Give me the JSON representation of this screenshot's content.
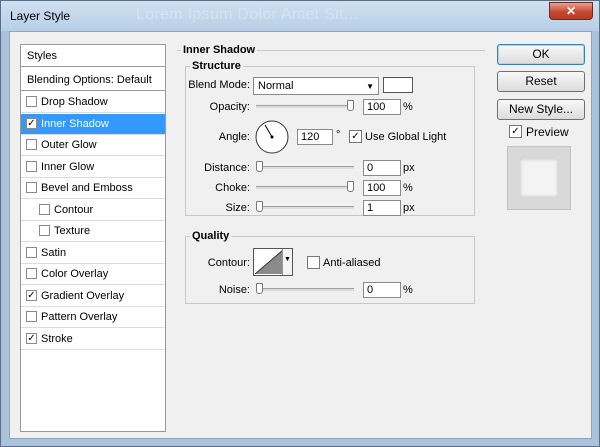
{
  "window": {
    "title": "Layer Style",
    "ghost_title": "Lorem Ipsum Dolor Amet Sit..."
  },
  "styles_panel": {
    "header": "Styles",
    "blending": "Blending Options: Default",
    "items": [
      {
        "label": "Drop Shadow",
        "checked": false,
        "indent": false,
        "selected": false
      },
      {
        "label": "Inner Shadow",
        "checked": true,
        "indent": false,
        "selected": true
      },
      {
        "label": "Outer Glow",
        "checked": false,
        "indent": false,
        "selected": false
      },
      {
        "label": "Inner Glow",
        "checked": false,
        "indent": false,
        "selected": false
      },
      {
        "label": "Bevel and Emboss",
        "checked": false,
        "indent": false,
        "selected": false
      },
      {
        "label": "Contour",
        "checked": false,
        "indent": true,
        "selected": false
      },
      {
        "label": "Texture",
        "checked": false,
        "indent": true,
        "selected": false
      },
      {
        "label": "Satin",
        "checked": false,
        "indent": false,
        "selected": false
      },
      {
        "label": "Color Overlay",
        "checked": false,
        "indent": false,
        "selected": false
      },
      {
        "label": "Gradient Overlay",
        "checked": true,
        "indent": false,
        "selected": false
      },
      {
        "label": "Pattern Overlay",
        "checked": false,
        "indent": false,
        "selected": false
      },
      {
        "label": "Stroke",
        "checked": true,
        "indent": false,
        "selected": false
      }
    ]
  },
  "inner_shadow": {
    "section_title": "Inner Shadow",
    "structure_title": "Structure",
    "blend_mode_label": "Blend Mode:",
    "blend_mode_value": "Normal",
    "shadow_color": "#ffffff",
    "opacity_label": "Opacity:",
    "opacity_value": "100",
    "opacity_unit": "%",
    "opacity_level": 1.0,
    "angle_label": "Angle:",
    "angle_value": "120",
    "angle_unit": "°",
    "global_light_label": "Use Global Light",
    "global_light_checked": true,
    "distance_label": "Distance:",
    "distance_value": "0",
    "distance_unit": "px",
    "distance_level": 0.0,
    "choke_label": "Choke:",
    "choke_value": "100",
    "choke_unit": "%",
    "choke_level": 1.0,
    "size_label": "Size:",
    "size_value": "1",
    "size_unit": "px",
    "size_level": 0.0
  },
  "quality": {
    "title": "Quality",
    "contour_label": "Contour:",
    "anti_aliased_label": "Anti-aliased",
    "anti_aliased_checked": false,
    "noise_label": "Noise:",
    "noise_value": "0",
    "noise_unit": "%",
    "noise_level": 0.0
  },
  "buttons": {
    "ok": "OK",
    "reset": "Reset",
    "new_style": "New Style...",
    "preview_label": "Preview",
    "preview_checked": true
  },
  "colors": {
    "selection": "#3399ff",
    "dialog_bg": "#f0f0f0",
    "frame": "#a9c3dd",
    "close": "#c44a34"
  }
}
